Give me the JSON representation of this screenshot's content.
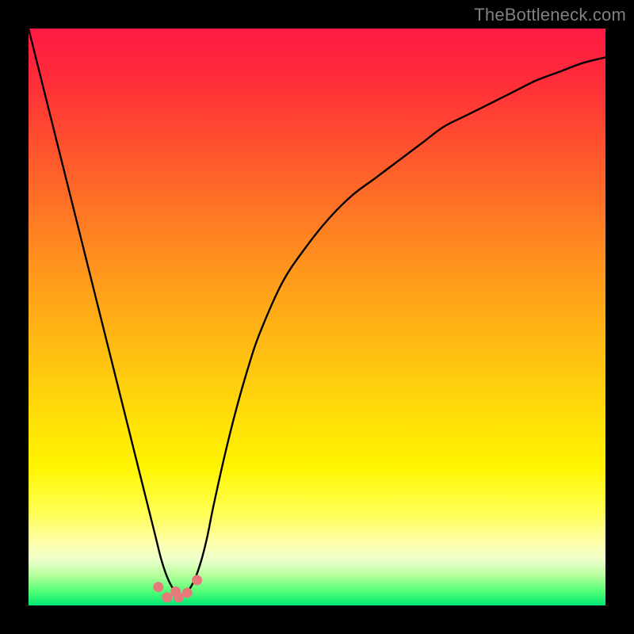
{
  "watermark": "TheBottleneck.com",
  "chart_data": {
    "type": "line",
    "title": "",
    "xlabel": "",
    "ylabel": "",
    "xlim": [
      0,
      100
    ],
    "ylim": [
      0,
      100
    ],
    "x": [
      0,
      2,
      4,
      6,
      8,
      10,
      12,
      14,
      16,
      18,
      20,
      21,
      22,
      23,
      24,
      25,
      26,
      27,
      28,
      29,
      30,
      31,
      32,
      34,
      36,
      38,
      40,
      44,
      48,
      52,
      56,
      60,
      64,
      68,
      72,
      76,
      80,
      84,
      88,
      92,
      96,
      100
    ],
    "series": [
      {
        "name": "bottleneck-curve",
        "values": [
          100,
          92,
          84,
          76,
          68,
          60,
          52,
          44,
          36,
          28,
          20,
          16,
          12,
          8,
          5,
          3,
          2,
          2,
          3,
          5,
          8,
          12,
          17,
          26,
          34,
          41,
          47,
          56,
          62,
          67,
          71,
          74,
          77,
          80,
          83,
          85,
          87,
          89,
          91,
          92.5,
          94,
          95
        ]
      }
    ],
    "markers": {
      "color": "#e77b7c",
      "points_x": [
        22.5,
        25.5,
        24.0,
        26.0,
        27.5,
        29.2
      ],
      "points_y": [
        3.2,
        2.4,
        1.4,
        1.4,
        2.2,
        4.4
      ]
    },
    "gradient_stops": [
      {
        "pos": 0,
        "color": "#ff1a44"
      },
      {
        "pos": 50,
        "color": "#ffa818"
      },
      {
        "pos": 80,
        "color": "#fff500"
      },
      {
        "pos": 100,
        "color": "#00e874"
      }
    ]
  }
}
